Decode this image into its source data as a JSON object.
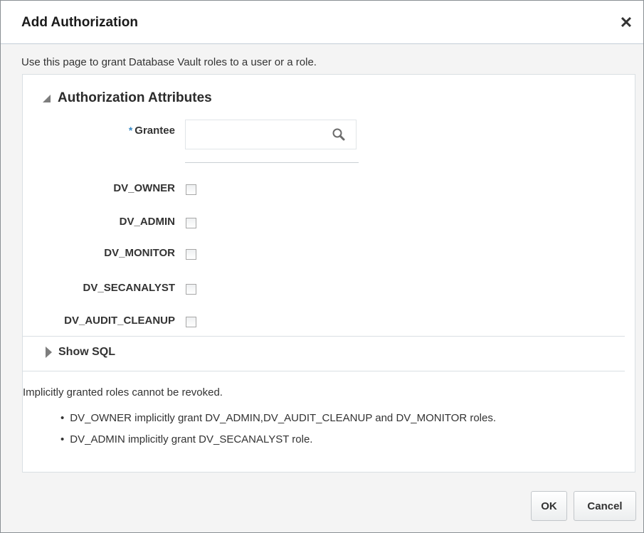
{
  "dialog": {
    "title": "Add Authorization",
    "close_symbol": "✕",
    "intro": "Use this page to grant Database Vault roles to a user or a role."
  },
  "section": {
    "title": "Authorization Attributes",
    "grantee": {
      "required_marker": "*",
      "label": "Grantee",
      "value": "",
      "placeholder": "",
      "icon": "search-icon"
    },
    "roles": [
      {
        "label": "DV_OWNER",
        "checked": false
      },
      {
        "label": "DV_ADMIN",
        "checked": false
      },
      {
        "label": "DV_MONITOR",
        "checked": false
      },
      {
        "label": "DV_SECANALYST",
        "checked": false
      },
      {
        "label": "DV_AUDIT_CLEANUP",
        "checked": false
      }
    ],
    "show_sql": "Show SQL"
  },
  "notes": {
    "intro": "Implicitly granted roles cannot be revoked.",
    "items": [
      "DV_OWNER implicitly grant DV_ADMIN,DV_AUDIT_CLEANUP and DV_MONITOR roles.",
      "DV_ADMIN implicitly grant DV_SECANALYST role."
    ]
  },
  "buttons": {
    "ok": "OK",
    "cancel": "Cancel"
  },
  "colors": {
    "required_marker": "#3a8ac4",
    "dialog_background": "#f4f4f4",
    "panel_border": "#d9dfe3"
  }
}
